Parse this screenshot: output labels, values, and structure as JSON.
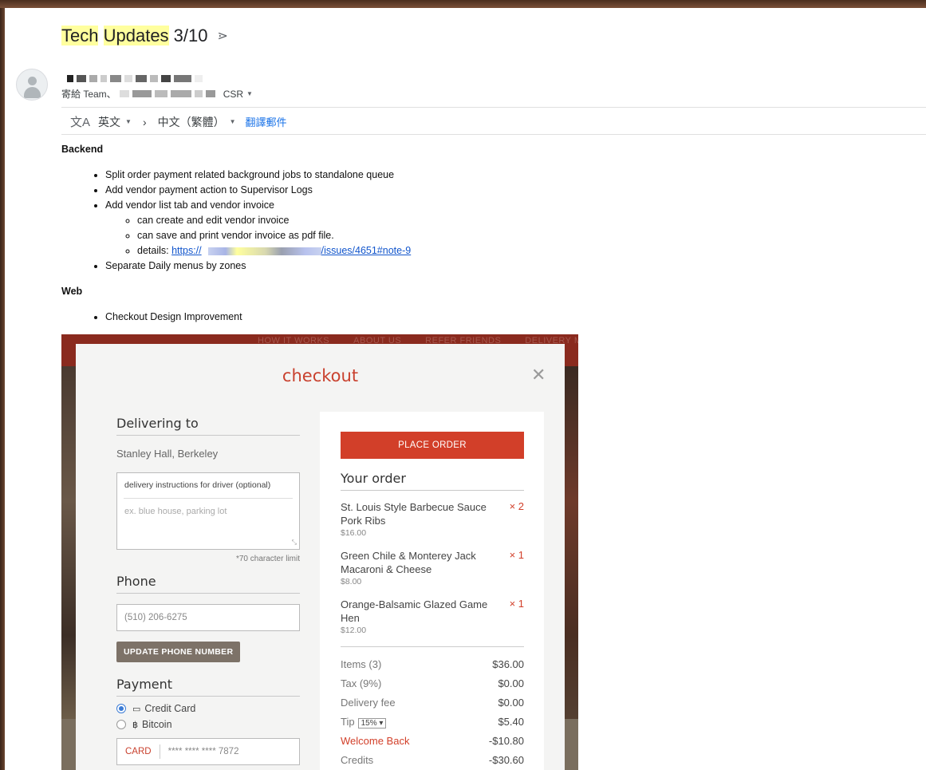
{
  "subject": {
    "word1": "Tech",
    "word2": "Updates",
    "rest": " 3/10"
  },
  "to": {
    "prefix": "寄給 Team、",
    "suffix": "CSR"
  },
  "translate": {
    "from": "英文",
    "to": "中文（繁體）",
    "link": "翻譯郵件"
  },
  "body": {
    "sections": [
      {
        "heading": "Backend",
        "items": [
          "Split order payment related background jobs to standalone queue",
          "Add vendor payment action to Supervisor Logs",
          "Add vendor list tab and vendor invoice",
          "Separate Daily menus by zones"
        ],
        "subitems": [
          "can create and edit vendor invoice",
          "can save and print vendor invoice as pdf file.",
          "details: "
        ],
        "link_start": "https://",
        "link_end": "/issues/4651#note-9"
      },
      {
        "heading": "Web",
        "items": [
          "Checkout Design Improvement"
        ]
      }
    ]
  },
  "screenshot": {
    "nav": [
      "HOW IT WORKS",
      "ABOUT US",
      "REFER FRIENDS",
      "DELIVERY MAP"
    ],
    "title": "checkout",
    "delivering_to": "Delivering to",
    "address": "Stanley Hall, Berkeley",
    "instructions_label": "delivery instructions for driver (optional)",
    "instructions_placeholder": "ex. blue house, parking lot",
    "char_limit": "*70 character limit",
    "phone_title": "Phone",
    "phone_value": "(510) 206-6275",
    "update_phone": "UPDATE PHONE NUMBER",
    "payment_title": "Payment",
    "pay_credit": "Credit Card",
    "pay_bitcoin": "Bitcoin",
    "card_label": "CARD",
    "card_number": "**** **** **** 7872",
    "place_order": "PLACE ORDER",
    "your_order": "Your order",
    "items": [
      {
        "name": "St. Louis Style Barbecue Sauce Pork Ribs",
        "qty": "× 2",
        "price": "$16.00"
      },
      {
        "name": "Green Chile & Monterey Jack Macaroni & Cheese",
        "qty": "× 1",
        "price": "$8.00"
      },
      {
        "name": "Orange-Balsamic Glazed Game Hen",
        "qty": "× 1",
        "price": "$12.00"
      }
    ],
    "summary": [
      {
        "label": "Items (3)",
        "value": "$36.00"
      },
      {
        "label": "Tax (9%)",
        "value": "$0.00"
      },
      {
        "label": "Delivery fee",
        "value": "$0.00"
      },
      {
        "label": "Tip",
        "value": "$5.40",
        "tip_option": "15%"
      },
      {
        "label": "Welcome Back",
        "value": "-$10.80"
      },
      {
        "label": "Credits",
        "value": "-$30.60"
      }
    ]
  },
  "colors": {
    "accent": "#d23f29",
    "highlight": "#ffff9e",
    "link": "#1155cc"
  }
}
